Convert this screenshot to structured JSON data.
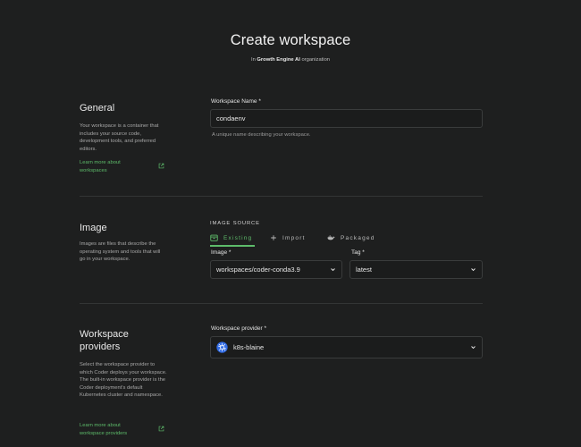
{
  "header": {
    "title": "Create workspace",
    "subtitle_prefix": "In ",
    "org_name": "Growth Engine AI",
    "subtitle_suffix": " organization"
  },
  "general": {
    "title": "General",
    "description": "Your workspace is a container that includes your source code, development tools, and preferred editors.",
    "learn_more": "Learn more about workspaces",
    "name_label": "Workspace Name *",
    "name_value": "condaenv",
    "name_help": "A unique name describing your workspace."
  },
  "image": {
    "title": "Image",
    "description": "Images are files that describe the operating system and tools that will go in your workspace.",
    "source_label": "IMAGE SOURCE",
    "tabs": [
      {
        "label": "Existing",
        "icon": "box-icon",
        "active": true
      },
      {
        "label": "Import",
        "icon": "plus-icon",
        "active": false
      },
      {
        "label": "Packaged",
        "icon": "docker-icon",
        "active": false
      }
    ],
    "image_label": "Image *",
    "image_value": "workspaces/coder-conda3.9",
    "tag_label": "Tag *",
    "tag_value": "latest"
  },
  "providers": {
    "title": "Workspace providers",
    "description": "Select the workspace provider to which Coder deploys your workspace. The built-in workspace provider is the Coder deployment's default Kubernetes cluster and namespace.",
    "learn_more": "Learn more about workspace providers",
    "provider_label": "Workspace provider *",
    "provider_value": "k8s-blaine",
    "provider_icon": "kubernetes-icon"
  },
  "colors": {
    "background": "#1e1f1f",
    "accent": "#5dbb6a",
    "kubernetes": "#326ce5"
  }
}
